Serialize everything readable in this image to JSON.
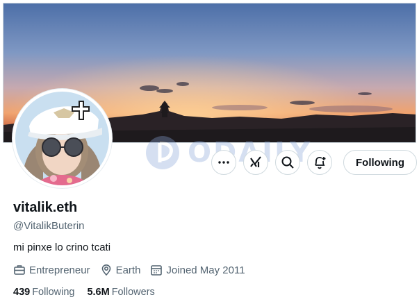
{
  "profile": {
    "display_name": "vitalik.eth",
    "handle": "@VitalikButerin",
    "bio": "mi pinxe lo crino tcati",
    "occupation": "Entrepreneur",
    "location": "Earth",
    "joined": "Joined May 2011",
    "following_count": "439",
    "following_label": "Following",
    "followers_count": "5.6M",
    "followers_label": "Followers"
  },
  "actions": {
    "more_icon": "more-horizontal-icon",
    "grok_icon": "grok-icon",
    "search_icon": "search-icon",
    "notify_icon": "bell-plus-icon",
    "follow_label": "Following"
  },
  "watermark": {
    "text": "ODAILY"
  },
  "colors": {
    "text_primary": "#0f1419",
    "text_secondary": "#536471",
    "border": "#cfd9de"
  }
}
